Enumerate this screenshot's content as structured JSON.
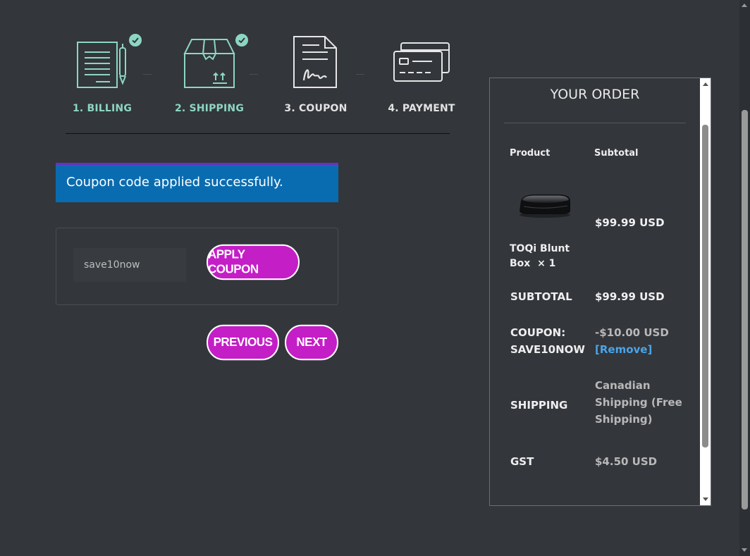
{
  "steps": [
    {
      "label": "1. BILLING",
      "icon": "billing-form-pen-icon",
      "status": "complete"
    },
    {
      "label": "2. SHIPPING",
      "icon": "shipping-box-icon",
      "status": "complete"
    },
    {
      "label": "3. COUPON",
      "icon": "signed-document-icon",
      "status": "current"
    },
    {
      "label": "4. PAYMENT",
      "icon": "payment-cards-icon",
      "status": "upcoming"
    }
  ],
  "notice": {
    "message": "Coupon code applied successfully."
  },
  "coupon": {
    "value": "save10now",
    "apply_label": "APPLY COUPON"
  },
  "nav": {
    "previous_label": "PREVIOUS",
    "next_label": "NEXT"
  },
  "order": {
    "title": "YOUR ORDER",
    "col_product": "Product",
    "col_subtotal": "Subtotal",
    "item": {
      "name": "TOQi Blunt Box",
      "qty": "× 1",
      "price": "$99.99 USD",
      "image": "black-box-product-image"
    },
    "subtotal": {
      "label": "SUBTOTAL",
      "value": "$99.99 USD"
    },
    "coupon_line": {
      "label_1": "COUPON:",
      "label_2": "SAVE10NOW",
      "value": "-$10.00 USD",
      "remove_label": "[Remove]"
    },
    "shipping": {
      "label": "SHIPPING",
      "value": "Canadian Shipping (Free Shipping)"
    },
    "tax": {
      "label": "GST",
      "value": "$4.50 USD"
    }
  },
  "colors": {
    "background": "#33363b",
    "step_complete": "#8cd6c4",
    "notice_bg": "#0a6cb0",
    "notice_border": "#6b2fc4",
    "button_bg": "#c41ec7",
    "link": "#4aa4e8"
  }
}
